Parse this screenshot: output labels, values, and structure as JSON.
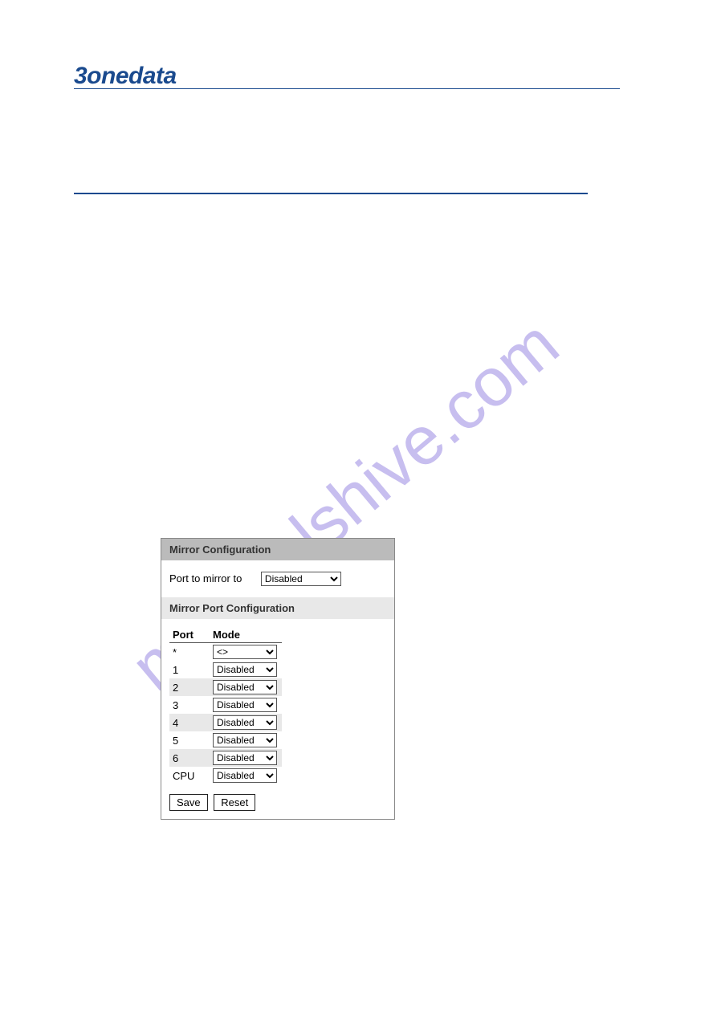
{
  "brand": "3onedata",
  "watermark": "manualshive.com",
  "panel": {
    "title": "Mirror Configuration",
    "mirror_to_label": "Port to mirror to",
    "mirror_to_value": "Disabled",
    "section_title": "Mirror Port Configuration",
    "columns": {
      "port": "Port",
      "mode": "Mode"
    },
    "rows": [
      {
        "port": "*",
        "mode": "<>",
        "alt": false
      },
      {
        "port": "1",
        "mode": "Disabled",
        "alt": false
      },
      {
        "port": "2",
        "mode": "Disabled",
        "alt": true
      },
      {
        "port": "3",
        "mode": "Disabled",
        "alt": false
      },
      {
        "port": "4",
        "mode": "Disabled",
        "alt": true
      },
      {
        "port": "5",
        "mode": "Disabled",
        "alt": false
      },
      {
        "port": "6",
        "mode": "Disabled",
        "alt": true
      },
      {
        "port": "CPU",
        "mode": "Disabled",
        "alt": false
      }
    ],
    "buttons": {
      "save": "Save",
      "reset": "Reset"
    }
  }
}
